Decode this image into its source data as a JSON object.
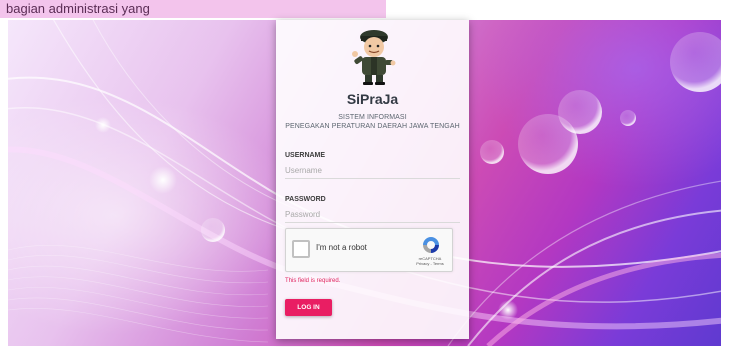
{
  "top_note": "bagian administrasi yang",
  "app": {
    "title": "SiPraJa",
    "subtitle_line1": "SISTEM INFORMASI",
    "subtitle_line2": "PENEGAKAN PERATURAN DAERAH JAWA TENGAH",
    "mascot_icon": "soldier-mascot-icon"
  },
  "form": {
    "username_label": "USERNAME",
    "username_placeholder": "Username",
    "username_value": "",
    "password_label": "PASSWORD",
    "password_placeholder": "Password",
    "password_value": ""
  },
  "recaptcha": {
    "label": "I'm not a robot",
    "brand": "reCAPTCHA",
    "links": "Privacy - Terms",
    "checked": false,
    "logo_icon": "recaptcha-logo-icon"
  },
  "error": "This field is required.",
  "login_button": "LOG IN",
  "colors": {
    "accent": "#e91e63",
    "error": "#e0245e"
  }
}
